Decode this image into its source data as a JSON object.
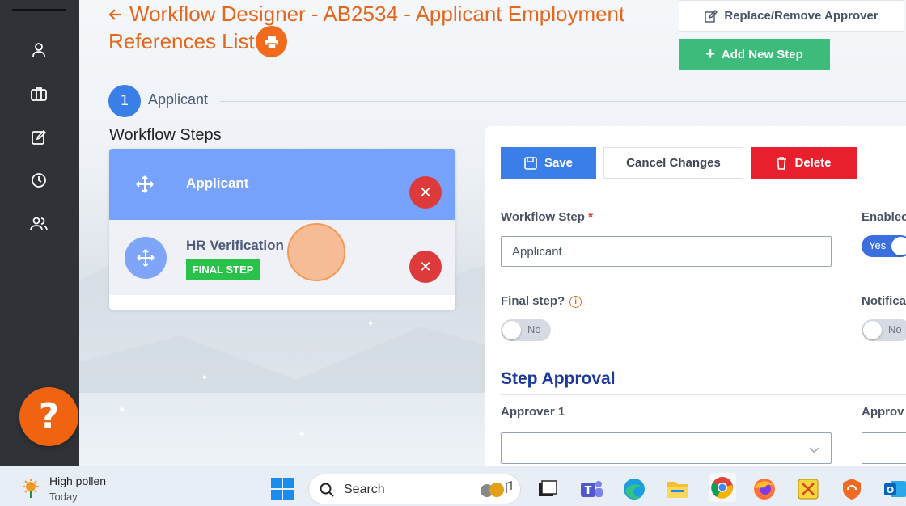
{
  "header": {
    "title": "Workflow Designer - AB2534 - Applicant Employment References List",
    "replace_label": "Replace/Remove Approver",
    "add_step_label": "Add New Step"
  },
  "stepper": {
    "number": "1",
    "label": "Applicant"
  },
  "workflow": {
    "heading": "Workflow Steps",
    "items": [
      {
        "name": "Applicant"
      },
      {
        "name": "HR Verification",
        "badge": "FINAL STEP"
      }
    ]
  },
  "form": {
    "save_label": "Save",
    "cancel_label": "Cancel Changes",
    "delete_label": "Delete",
    "workflow_step_label": "Workflow Step",
    "workflow_step_required": "*",
    "workflow_step_value": "Applicant",
    "enabled_label": "Enablec",
    "enabled_toggle": "Yes",
    "final_step_label": "Final step?",
    "final_step_toggle": "No",
    "notification_label": "Notifica",
    "notification_toggle": "No",
    "approval_title": "Step Approval",
    "approver1_label": "Approver 1",
    "approver2_label": "Approv",
    "approver1_value": ""
  },
  "taskbar": {
    "weather_title": "High pollen",
    "weather_sub": "Today",
    "search_placeholder": "Search"
  },
  "help": {
    "label": "?"
  },
  "colors": {
    "accent": "#e4671b",
    "primary": "#3b7ee8",
    "success": "#3dbb7a",
    "danger": "#e8202e"
  }
}
